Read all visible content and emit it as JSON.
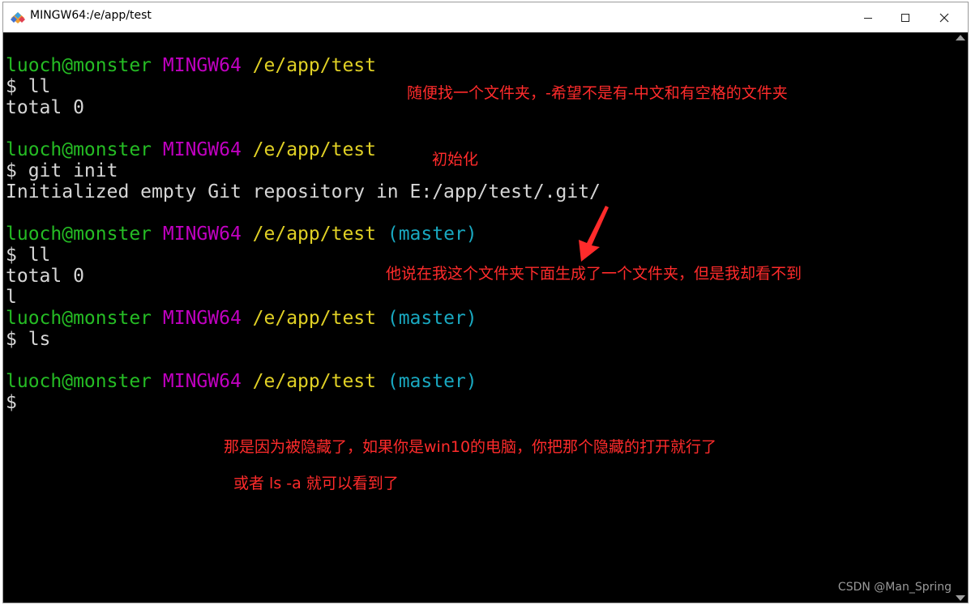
{
  "window": {
    "title": "MINGW64:/e/app/test",
    "minimize_glyph": "—",
    "maximize_glyph": "☐",
    "close_glyph": "✕",
    "icon": "git-bash-icon"
  },
  "terminal": {
    "prompt_user": "luoch@monster",
    "prompt_env": "MINGW64",
    "prompt_path": "/e/app/test",
    "prompt_branch": "(master)",
    "lines": [
      "$ ll",
      "total 0",
      "$ git init",
      "Initialized empty Git repository in E:/app/test/.git/",
      "$ ll",
      "total 0",
      "l",
      "$ ls",
      "$"
    ]
  },
  "annotations": {
    "note1": "随便找一个文件夹，-希望不是有-中文和有空格的文件夹",
    "note2": "初始化",
    "note3": "他说在我这个文件夹下面生成了一个文件夹，但是我却看不到",
    "note4": "那是因为被隐藏了，如果你是win10的电脑，你把那个隐藏的打开就行了",
    "note5": "或者 ls -a 就可以看到了",
    "color": "#ff2b2b"
  },
  "watermark": "CSDN @Man_Spring",
  "colors": {
    "prompt_user": "#25bc24",
    "prompt_env": "#c000c0",
    "prompt_path": "#e0d025",
    "prompt_branch": "#19a8c0",
    "terminal_bg": "#000000",
    "terminal_text": "#d6d6d6"
  }
}
